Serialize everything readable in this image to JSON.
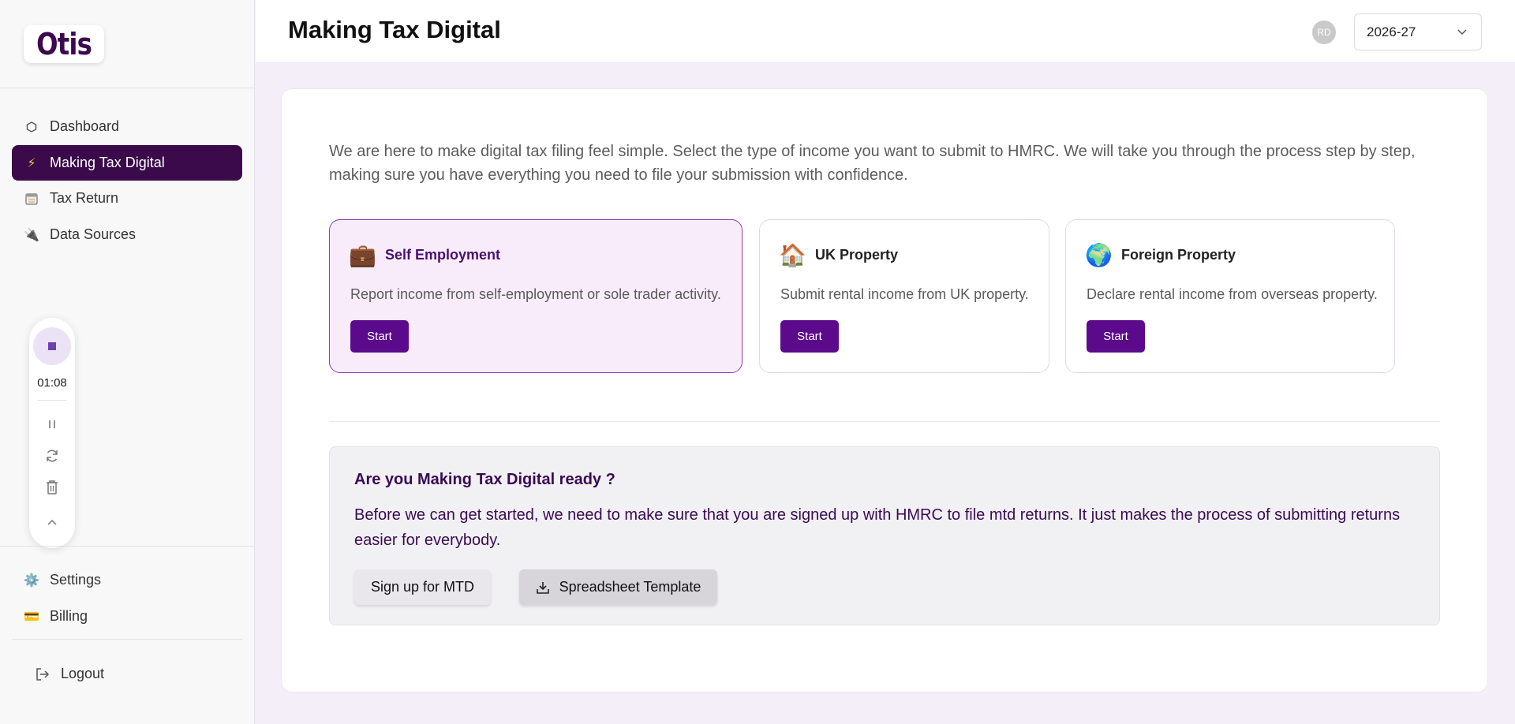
{
  "brand": {
    "logo_text": "Otis"
  },
  "sidebar": {
    "items": [
      {
        "label": "Dashboard",
        "icon": "hexagon-icon"
      },
      {
        "label": "Making Tax Digital",
        "icon": "lightning-icon",
        "active": true
      },
      {
        "label": "Tax Return",
        "icon": "calendar-icon"
      },
      {
        "label": "Data Sources",
        "icon": "plug-icon"
      }
    ],
    "bottom_items": [
      {
        "label": "Settings",
        "icon": "gear-icon"
      },
      {
        "label": "Billing",
        "icon": "credit-card-icon"
      }
    ],
    "logout_label": "Logout"
  },
  "recorder": {
    "time": "01:08"
  },
  "header": {
    "title": "Making Tax Digital",
    "avatar_initials": "RD",
    "tax_year": "2026-27"
  },
  "main": {
    "intro": "We are here to make digital tax filing feel simple. Select the type of income you want to submit to HMRC. We will take you through the process step by step, making sure you have everything you need to file your submission with confidence.",
    "income_types": [
      {
        "title": "Self Employment",
        "emoji": "💼",
        "description": "Report income from self-employment or sole trader activity.",
        "button": "Start",
        "selected": true
      },
      {
        "title": "UK Property",
        "emoji": "🏠",
        "description": "Submit rental income from UK property.",
        "button": "Start"
      },
      {
        "title": "Foreign Property",
        "emoji": "🌍",
        "description": "Declare rental income from overseas property.",
        "button": "Start"
      }
    ],
    "mtd": {
      "title": "Are you Making Tax Digital ready ?",
      "text": "Before we can get started, we need to make sure that you are signed up with HMRC to file mtd returns. It just makes the process of submitting returns easier for everybody.",
      "signup_label": "Sign up for MTD",
      "template_label": "Spreadsheet Template"
    }
  },
  "colors": {
    "brand_dark": "#3a0a4a",
    "button_purple": "#5b0a8c",
    "selected_bg": "#f8ecfa",
    "page_bg": "#f4eef8"
  }
}
